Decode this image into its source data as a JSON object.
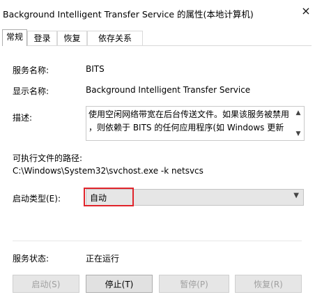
{
  "window": {
    "title": "Background Intelligent Transfer Service 的属性(本地计算机)",
    "close_glyph": "×"
  },
  "tabs": [
    {
      "label": "常规",
      "active": true
    },
    {
      "label": "登录",
      "active": false
    },
    {
      "label": "恢复",
      "active": false
    },
    {
      "label": "依存关系",
      "active": false
    }
  ],
  "general": {
    "service_name_label": "服务名称:",
    "service_name_value": "BITS",
    "display_name_label": "显示名称:",
    "display_name_value": "Background Intelligent Transfer Service",
    "description_label": "描述:",
    "description_line1": "使用空闲网络带宽在后台传送文件。如果该服务被禁用",
    "description_line2": "，则依赖于 BITS 的任何应用程序(如 Windows 更新",
    "exe_path_label": "可执行文件的路径:",
    "exe_path_value": "C:\\Windows\\System32\\svchost.exe -k netsvcs",
    "startup_type_label": "启动类型(E):",
    "startup_type_value": "自动",
    "service_status_label": "服务状态:",
    "service_status_value": "正在运行"
  },
  "buttons": {
    "start": "启动(S)",
    "stop": "停止(T)",
    "pause": "暂停(P)",
    "resume": "恢复(R)"
  },
  "colors": {
    "highlight_border": "#e0242b"
  }
}
